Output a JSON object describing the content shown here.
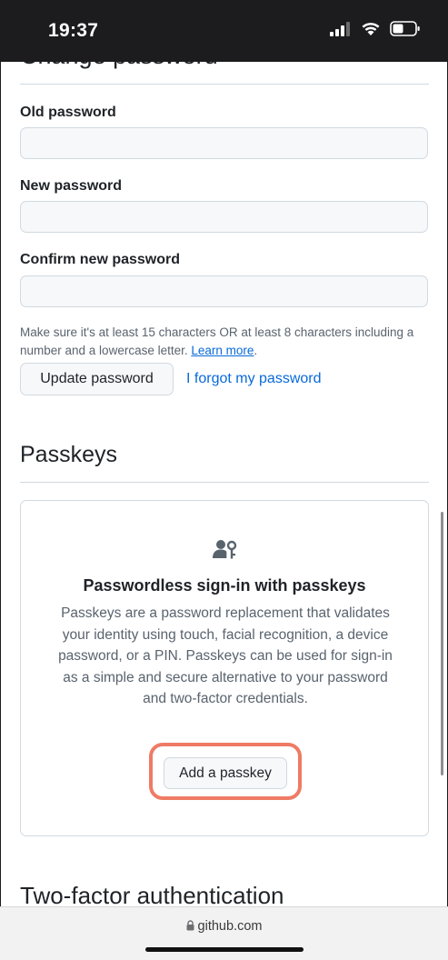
{
  "status_bar": {
    "time": "19:37"
  },
  "settings": {
    "change_password_heading": "Change password",
    "old_password_label": "Old password",
    "new_password_label": "New password",
    "confirm_password_label": "Confirm new password",
    "hint_text": "Make sure it's at least 15 characters OR at least 8 characters including a number and a lowercase letter.",
    "learn_more": "Learn more",
    "hint_end": ".",
    "update_button": "Update password",
    "forgot_link": "I forgot my password",
    "passkeys_heading": "Passkeys",
    "passkeys_title": "Passwordless sign-in with passkeys",
    "passkeys_desc": "Passkeys are a password replacement that validates your identity using touch, facial recognition, a device password, or a PIN. Passkeys can be used for sign-in as a simple and secure alternative to your password and two-factor credentials.",
    "add_passkey_button": "Add a passkey",
    "two_factor_heading": "Two-factor authentication"
  },
  "browser": {
    "url": "github.com"
  },
  "colors": {
    "highlight": "#ef7b65",
    "link": "#0969da",
    "muted_text": "#59636e",
    "input_bg": "#f6f8fa"
  },
  "icons": [
    "cellular-signal-icon",
    "wifi-icon",
    "battery-icon",
    "person-key-icon",
    "lock-icon"
  ]
}
